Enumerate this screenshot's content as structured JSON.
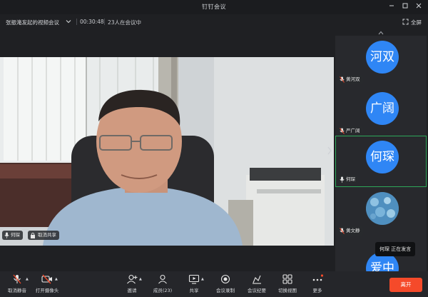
{
  "window": {
    "title": "钉钉会议"
  },
  "info_bar": {
    "meeting_name": "张振淹发起的视频会议",
    "timer": "00:30:48",
    "attendees": "23人在会议中",
    "fullscreen_label": "全屏"
  },
  "main_video": {
    "participants": [
      {
        "name": "何琛"
      },
      {
        "name": "取消共享"
      }
    ]
  },
  "sidebar": {
    "tiles": [
      {
        "avatar_text": "河双",
        "name": "黄河双",
        "avatar_color": "#2f86f5"
      },
      {
        "avatar_text": "广阔",
        "name": "严广阔",
        "avatar_color": "#2f86f5"
      },
      {
        "avatar_text": "何琛",
        "name": "何琛",
        "avatar_color": "#2f86f5"
      },
      {
        "avatar_text": "",
        "name": "黄文静",
        "avatar_color": "#4a86b5"
      },
      {
        "avatar_text": "爱中",
        "name": "",
        "avatar_color": "#2f86f5"
      }
    ]
  },
  "speaking_tip": {
    "text": "何琛  正在发言"
  },
  "toolbar": {
    "items": [
      {
        "label": "取消静音",
        "icon": "mic-muted-icon"
      },
      {
        "label": "打开摄像头",
        "icon": "camera-off-icon"
      },
      {
        "label": "邀请",
        "icon": "invite-user-icon"
      },
      {
        "label": "成员(23)",
        "icon": "members-icon"
      },
      {
        "label": "共享",
        "icon": "share-screen-icon"
      },
      {
        "label": "会议录制",
        "icon": "record-icon"
      },
      {
        "label": "会议纪要",
        "icon": "minutes-icon"
      },
      {
        "label": "切换视图",
        "icon": "switch-view-icon"
      },
      {
        "label": "更多",
        "icon": "more-icon"
      }
    ],
    "leave_label": "离开"
  },
  "colors": {
    "accent_avatar": "#2f86f5",
    "active_border": "#2ea85a",
    "leave_button": "#f54a2a",
    "background": "#1f2023"
  }
}
